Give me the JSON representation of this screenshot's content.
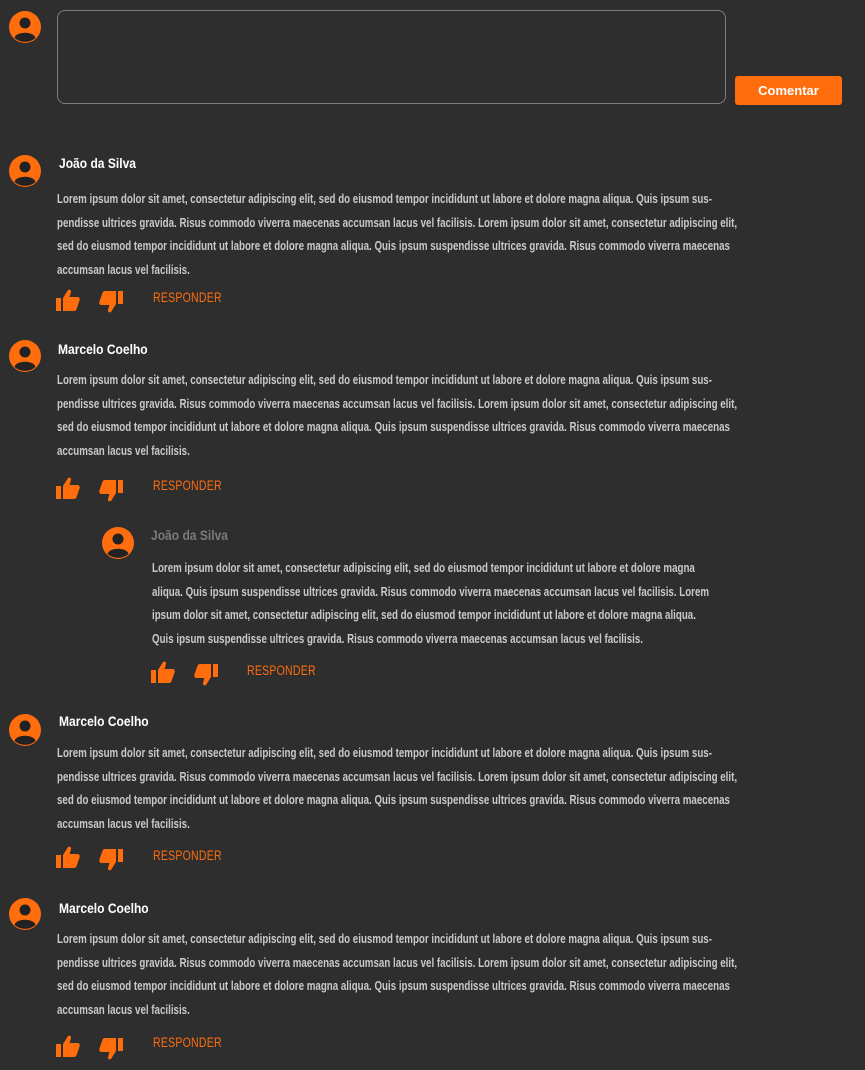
{
  "composer": {
    "value": "",
    "placeholder": "",
    "button_label": "Comentar"
  },
  "comments": [
    {
      "author": "João da Silva",
      "lines": [
        "Lorem ipsum dolor sit amet, consectetur adipiscing elit, sed do eiusmod tempor incididunt ut labore et dolore magna aliqua. Quis ipsum sus-",
        "pendisse ultrices gravida. Risus commodo viverra maecenas accumsan lacus vel facilisis. Lorem ipsum dolor sit amet, consectetur adipiscing elit,",
        "sed do eiusmod tempor incididunt ut labore et dolore magna aliqua. Quis ipsum suspendisse ultrices gravida. Risus commodo viverra maecenas",
        "accumsan lacus vel facilisis."
      ],
      "reply_label": "RESPONDER"
    },
    {
      "author": "Marcelo Coelho",
      "lines": [
        "Lorem ipsum dolor sit amet, consectetur adipiscing elit, sed do eiusmod tempor incididunt ut labore et dolore magna aliqua. Quis ipsum sus-",
        "pendisse ultrices gravida. Risus commodo viverra maecenas accumsan lacus vel facilisis. Lorem ipsum dolor sit amet, consectetur adipiscing elit,",
        "sed do eiusmod tempor incididunt ut labore et dolore magna aliqua. Quis ipsum suspendisse ultrices gravida. Risus commodo viverra maecenas",
        "accumsan lacus vel facilisis."
      ],
      "reply_label": "RESPONDER"
    },
    {
      "author": "João da Silva",
      "lines": [
        "Lorem ipsum dolor sit amet, consectetur adipiscing elit, sed do eiusmod tempor incididunt ut labore et dolore magna",
        "aliqua. Quis ipsum suspendisse ultrices gravida. Risus commodo viverra maecenas accumsan lacus vel facilisis. Lorem",
        "ipsum dolor sit amet, consectetur adipiscing elit, sed do eiusmod tempor incididunt ut labore et dolore magna aliqua.",
        "Quis ipsum suspendisse ultrices gravida. Risus commodo viverra maecenas accumsan lacus vel facilisis."
      ],
      "reply_label": "RESPONDER"
    },
    {
      "author": "Marcelo Coelho",
      "lines": [
        "Lorem ipsum dolor sit amet, consectetur adipiscing elit, sed do eiusmod tempor incididunt ut labore et dolore magna aliqua. Quis ipsum sus-",
        "pendisse ultrices gravida. Risus commodo viverra maecenas accumsan lacus vel facilisis. Lorem ipsum dolor sit amet, consectetur adipiscing elit,",
        "sed do eiusmod tempor incididunt ut labore et dolore magna aliqua. Quis ipsum suspendisse ultrices gravida. Risus commodo viverra maecenas",
        "accumsan lacus vel facilisis."
      ],
      "reply_label": "RESPONDER"
    },
    {
      "author": "Marcelo Coelho",
      "lines": [
        "Lorem ipsum dolor sit amet, consectetur adipiscing elit, sed do eiusmod tempor incididunt ut labore et dolore magna aliqua. Quis ipsum sus-",
        "pendisse ultrices gravida. Risus commodo viverra maecenas accumsan lacus vel facilisis. Lorem ipsum dolor sit amet, consectetur adipiscing elit,",
        "sed do eiusmod tempor incididunt ut labore et dolore magna aliqua. Quis ipsum suspendisse ultrices gravida. Risus commodo viverra maecenas",
        "accumsan lacus vel facilisis."
      ],
      "reply_label": "RESPONDER"
    }
  ],
  "icons": {
    "avatar": "user-avatar-icon",
    "like": "thumbs-up-icon",
    "dislike": "thumbs-down-icon"
  },
  "colors": {
    "background": "#2e2e2e",
    "accent": "#ff6d0d",
    "reply_author": "#7a7a7a"
  }
}
